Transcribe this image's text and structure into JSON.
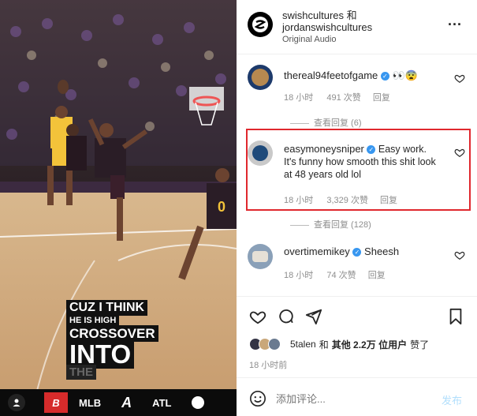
{
  "post": {
    "header": {
      "line1": "swishcultures 和",
      "line2": "jordanswishcultures",
      "audio": "Original Audio",
      "more": "..."
    },
    "comments": [
      {
        "user": "thereal94feetofgame",
        "text": "👀😨",
        "time": "18 小时",
        "likes": "491 次赞",
        "reply": "回复",
        "view_replies": "查看回复 (6)"
      },
      {
        "user": "easymoneysniper",
        "text": "Easy work. It's funny how smooth this shit look at 48 years old lol",
        "time": "18 小时",
        "likes": "3,329 次赞",
        "reply": "回复",
        "view_replies": "查看回复 (128)"
      },
      {
        "user": "overtimemikey",
        "text": "Sheesh",
        "time": "18 小时",
        "likes": "74 次赞",
        "reply": "回复"
      }
    ],
    "likes_line": {
      "user": "5talen",
      "and": "和",
      "others": "其他 2.2万 位用户",
      "suffix": "赞了"
    },
    "time_ago": "18 小时前",
    "comment_box": {
      "placeholder": "添加评论...",
      "post": "发布"
    }
  },
  "video_overlay": {
    "caption": [
      "CUZ I THINK",
      "HE IS HIGH",
      "CROSSOVER",
      "INTO",
      "THE"
    ],
    "scoreboard": [
      "MLB",
      "ATL"
    ],
    "jersey_number": "0"
  }
}
